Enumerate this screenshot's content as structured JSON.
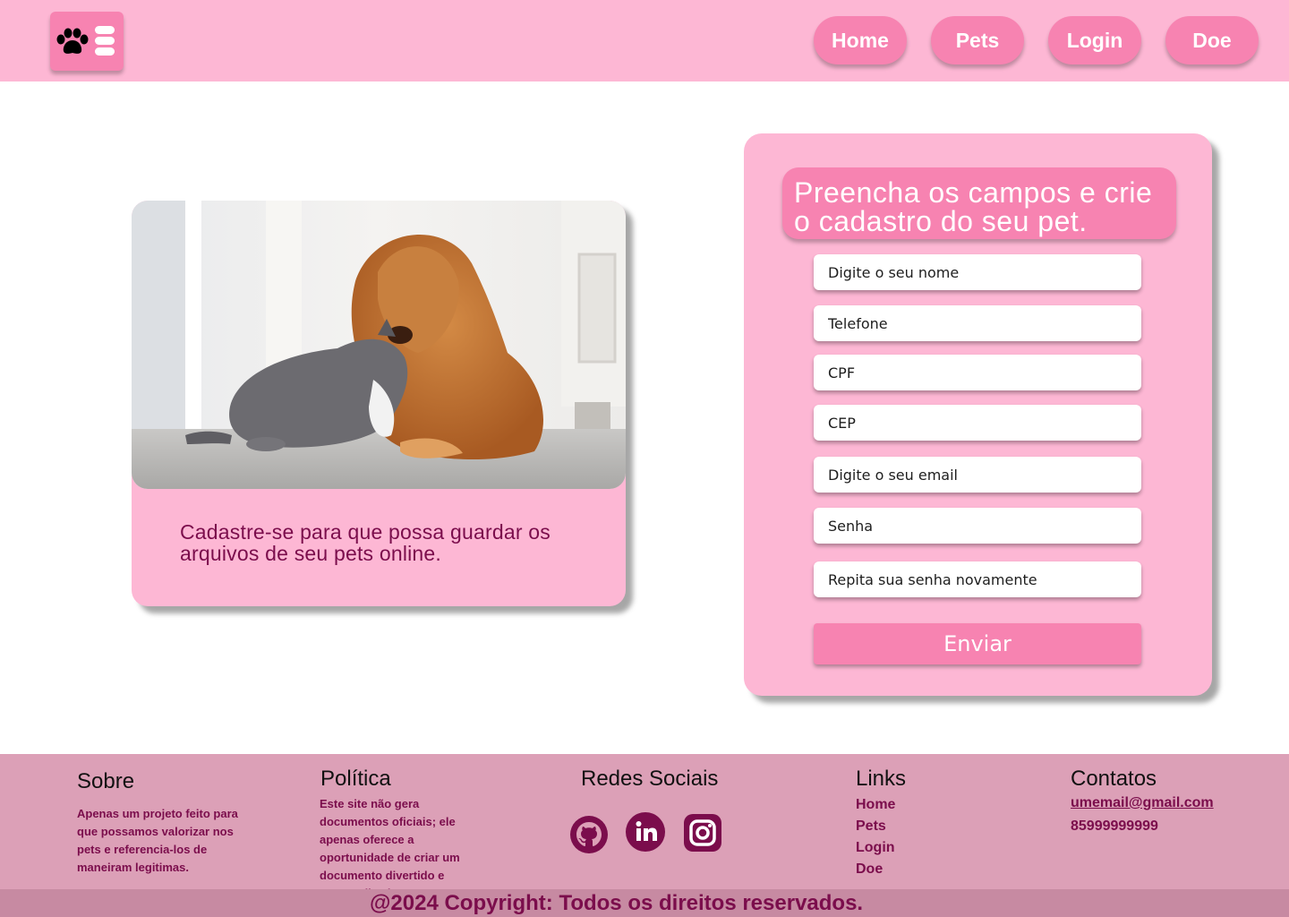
{
  "header": {
    "nav": [
      "Home",
      "Pets",
      "Login",
      "Doe"
    ]
  },
  "hero": {
    "text": "Cadastre-se para que possa guardar os arquivos de seu pets online."
  },
  "form": {
    "title": "Preencha os campos e crie o cadastro do seu pet.",
    "fields": [
      {
        "placeholder": "Digite o seu nome"
      },
      {
        "placeholder": "Telefone"
      },
      {
        "placeholder": "CPF"
      },
      {
        "placeholder": "CEP"
      },
      {
        "placeholder": "Digite o seu email"
      },
      {
        "placeholder": "Senha"
      },
      {
        "placeholder": "Repita sua senha novamente"
      }
    ],
    "submit": "Enviar"
  },
  "footer": {
    "sobre": {
      "title": "Sobre",
      "text": "Apenas um projeto feito para que possamos valorizar nos pets e referencia-los de maneiram legitimas."
    },
    "politica": {
      "title": "Política",
      "text": "Este site não gera documentos oficiais; ele apenas oferece a oportunidade de criar um documento divertido e personalizado para o seu pet."
    },
    "redes": {
      "title": "Redes Sociais",
      "icons": [
        "github-icon",
        "linkedin-icon",
        "instagram-icon"
      ]
    },
    "links": {
      "title": "Links",
      "items": [
        "Home",
        "Pets",
        "Login",
        "Doe"
      ]
    },
    "contatos": {
      "title": "Contatos",
      "email": "umemail@gmail.com",
      "phone": "85999999999"
    },
    "copyright": "@2024 Copyright: Todos os direitos reservados."
  },
  "colors": {
    "header_bg": "#fdb7d4",
    "accent": "#f783b1",
    "text_dark": "#7b0d4c",
    "footer_bg": "#dca0b7",
    "copyright_bg": "#c78aa2"
  }
}
